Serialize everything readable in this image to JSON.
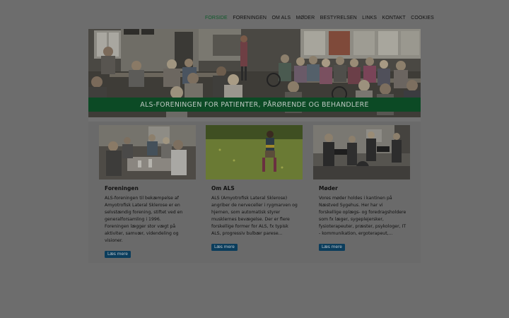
{
  "nav": {
    "items": [
      {
        "label": "FORSIDE",
        "active": true
      },
      {
        "label": "FORENINGEN",
        "active": false
      },
      {
        "label": "OM ALS",
        "active": false
      },
      {
        "label": "MØDER",
        "active": false
      },
      {
        "label": "BESTYRELSEN",
        "active": false
      },
      {
        "label": "LINKS",
        "active": false
      },
      {
        "label": "KONTAKT",
        "active": false
      },
      {
        "label": "COOKIES",
        "active": false
      }
    ]
  },
  "hero": {
    "banner": "ALS-FORENINGEN FOR PATIENTER, PÅRØRENDE OG BEHANDLERE"
  },
  "cards": [
    {
      "title": "Foreningen",
      "text": "ALS-foreningen til bekæmpelse af Amyotrofisk Lateral Sklerose er en selvstændig forening, stiftet ved en generalforsamling i 1996.\nForeningen lægger stor vægt på aktiviter, samvær, videndeling og visioner.",
      "button": "Læs mere"
    },
    {
      "title": "Om ALS",
      "text": "ALS (Amyotrofisk Lateral Sklerose) angriber de nerveceller i rygmarven og hjernen, som automatisk styrer musklernes bevægelse. Der er flere forskellige former for ALS, fx typisk ALS, progressiv bulbær parese...",
      "button": "Læs mere"
    },
    {
      "title": "Møder",
      "text": "Vores møder holdes i kantinen på Næstved Sygehus. Her har vi forskellige oplægs- og foredragsholdere som fx læger, sygeplejersker, fysioterapeuter, præster, psykologer, IT - kommunikation, ergoterapeut,...",
      "button": "Læs mere"
    }
  ],
  "colors": {
    "page_bg": "#6d6d6d",
    "nav_active": "#0f5a2b",
    "banner_bg": "#0c4a25",
    "button_bg": "#0b3d5c"
  }
}
